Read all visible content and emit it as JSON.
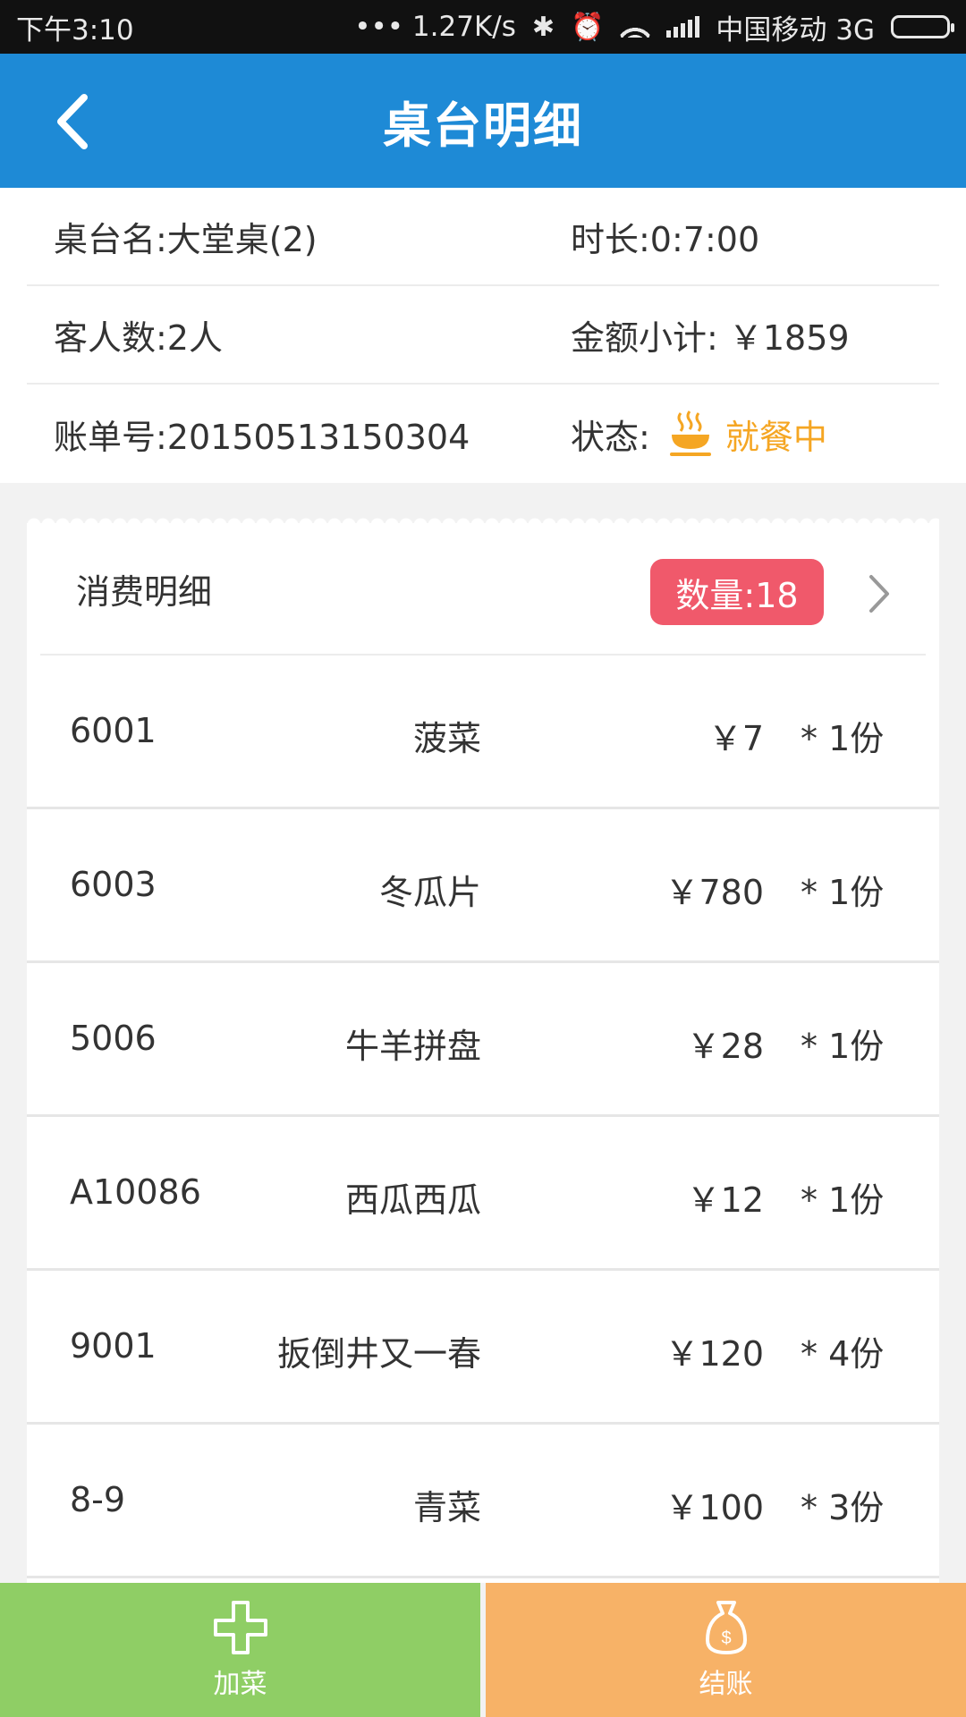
{
  "status_bar": {
    "time": "下午3:10",
    "network_speed": "••• 1.27K/s",
    "carrier": "中国移动 3G"
  },
  "header": {
    "title": "桌台明细",
    "back_icon": "chevron-left-icon"
  },
  "info": {
    "table_name": "桌台名:大堂桌(2)",
    "duration": "时长:0:7:00",
    "guests": "客人数:2人",
    "subtotal": "金额小计: ￥1859",
    "bill_no": "账单号:20150513150304",
    "status_label": "状态:",
    "status_value": "就餐中",
    "status_color": "#f5a623"
  },
  "detail": {
    "title": "消费明细",
    "count": "数量:18",
    "badge_color": "#f0596b",
    "items": [
      {
        "code": "6001",
        "name": "菠菜",
        "price": "￥7",
        "qty": "* 1份"
      },
      {
        "code": "6003",
        "name": "冬瓜片",
        "price": "￥780",
        "qty": "* 1份"
      },
      {
        "code": "5006",
        "name": "牛羊拼盘",
        "price": "￥28",
        "qty": "* 1份"
      },
      {
        "code": "A10086",
        "name": "西瓜西瓜",
        "price": "￥12",
        "qty": "* 1份"
      },
      {
        "code": "9001",
        "name": "扳倒井又一春",
        "price": "￥120",
        "qty": "* 4份"
      },
      {
        "code": "8-9",
        "name": "青菜",
        "price": "￥100",
        "qty": "* 3份"
      }
    ]
  },
  "actions": {
    "add_label": "加菜",
    "pay_label": "结账",
    "add_color": "#8fce65",
    "pay_color": "#f7b267"
  }
}
